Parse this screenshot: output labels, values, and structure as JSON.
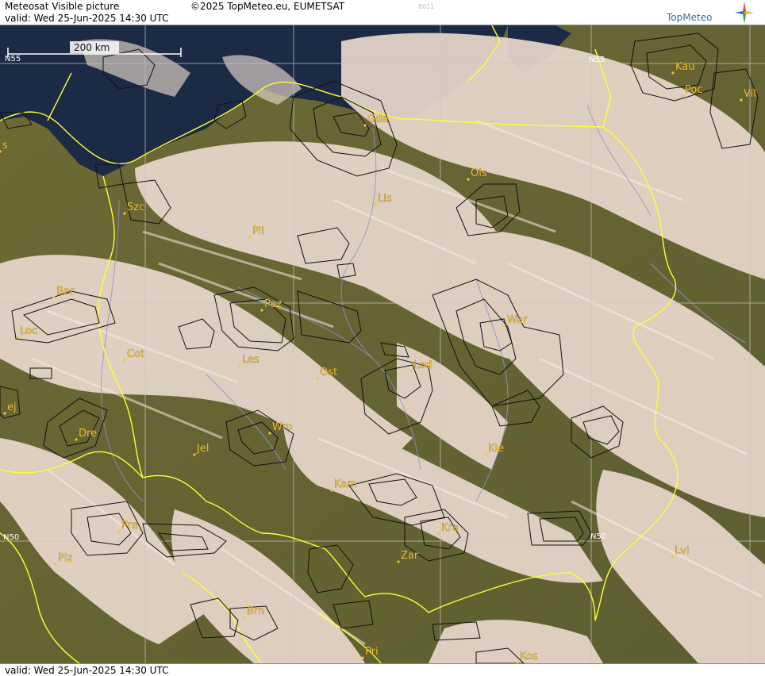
{
  "header": {
    "title": "Meteosat Visible picture",
    "copyright": "©2025 TopMeteo.eu, EUMETSAT",
    "code": "8011",
    "valid": "valid:  Wed  25-Jun-2025  14:30 UTC",
    "logo_text": "TopMeteo"
  },
  "footer": {
    "valid": "valid:  Wed  25-Jun-2025  14:30 UTC"
  },
  "map": {
    "scale_label": "200 km",
    "lat_labels": {
      "n55_left": "N55",
      "n55_right": "N55",
      "n50_left": "N50",
      "n50_right": "N50"
    },
    "cities": [
      {
        "name": "Gda"
      },
      {
        "name": "Kau"
      },
      {
        "name": "Poc"
      },
      {
        "name": "Vil"
      },
      {
        "name": "Szc"
      },
      {
        "name": "Ols"
      },
      {
        "name": "Lis"
      },
      {
        "name": "Pil"
      },
      {
        "name": "Ber"
      },
      {
        "name": "Poz"
      },
      {
        "name": "Loc"
      },
      {
        "name": "War"
      },
      {
        "name": "Cot"
      },
      {
        "name": "Les"
      },
      {
        "name": "Lod"
      },
      {
        "name": "Ost"
      },
      {
        "name": "ej"
      },
      {
        "name": "Dre"
      },
      {
        "name": "Wro"
      },
      {
        "name": "Jel"
      },
      {
        "name": "Kie"
      },
      {
        "name": "Kam"
      },
      {
        "name": "Pra"
      },
      {
        "name": "Kra"
      },
      {
        "name": "Plz"
      },
      {
        "name": "Zar"
      },
      {
        "name": "Lvi"
      },
      {
        "name": "Brn"
      },
      {
        "name": "Pri"
      },
      {
        "name": "Kos"
      },
      {
        "name": "s"
      }
    ],
    "colors": {
      "border": "#ffff33",
      "grid": "#c8c8c8",
      "city_label": "#f2c53a",
      "sea": "#1c2b45",
      "land": "#6e6a35",
      "cloud": "#e8d8cc"
    }
  }
}
